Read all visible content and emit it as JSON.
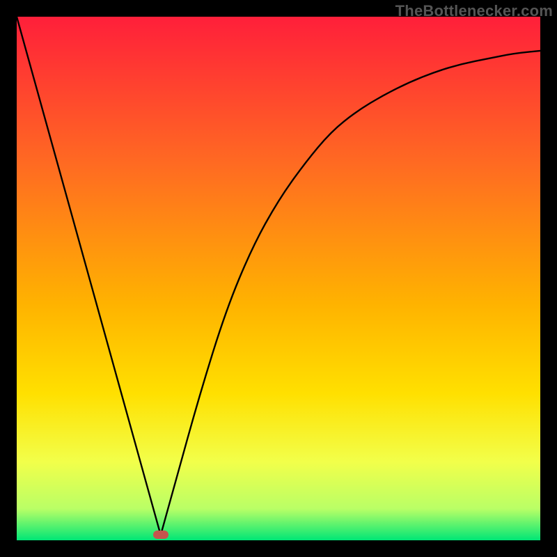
{
  "watermark": {
    "text": "TheBottlenecker.com"
  },
  "colors": {
    "black": "#000000",
    "curve": "#000000",
    "marker": "#c4554d",
    "band_a": "#ff1f3a",
    "band_b": "#ff6a22",
    "band_c": "#ffb300",
    "band_d": "#ffe000",
    "band_e": "#f2ff4a",
    "band_f": "#b9ff66",
    "band_g": "#00e676"
  },
  "chart_data": {
    "type": "line",
    "title": "",
    "xlabel": "",
    "ylabel": "",
    "xlim": [
      0,
      100
    ],
    "ylim": [
      0,
      100
    ],
    "legend": false,
    "grid": false,
    "annotations": [
      "TheBottlenecker.com"
    ],
    "note": "x is a normalized position 0–100 across the plot width; y is normalized 0–100 where 0 is bottom (green) and 100 is top (red).",
    "series": [
      {
        "name": "left-segment",
        "x": [
          0,
          5,
          10,
          15,
          20,
          25,
          27.5
        ],
        "values": [
          100,
          82,
          64,
          46,
          28,
          10,
          1
        ]
      },
      {
        "name": "right-segment",
        "x": [
          27.5,
          30,
          35,
          40,
          45,
          50,
          55,
          60,
          65,
          70,
          75,
          80,
          85,
          90,
          95,
          100
        ],
        "values": [
          1,
          10,
          28,
          44,
          56,
          65,
          72,
          78,
          82,
          85,
          87.5,
          89.5,
          91,
          92,
          93,
          93.5
        ]
      }
    ],
    "marker": {
      "x": 27.5,
      "y": 1,
      "color": "#c4554d"
    }
  }
}
